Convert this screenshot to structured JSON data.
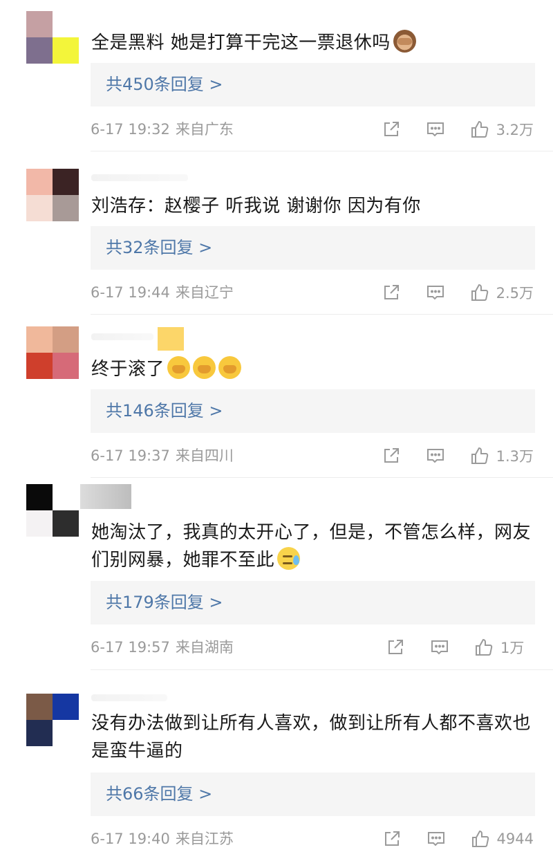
{
  "comments": [
    {
      "text": "全是黑料 她是打算干完这一票退休吗",
      "emojis": [
        "monkey"
      ],
      "reply_label": "共450条回复 >",
      "date": "6-17 19:32",
      "location": "来自广东",
      "likes": "3.2万",
      "avatar_colors": [
        "#c5a0a3",
        "#ffffff",
        "#7e6f8e",
        "#f3f53a"
      ]
    },
    {
      "text": "刘浩存：赵樱子 听我说 谢谢你 因为有你",
      "emojis": [],
      "reply_label": "共32条回复 >",
      "date": "6-17 19:44",
      "location": "来自辽宁",
      "likes": "2.5万",
      "avatar_colors": [
        "#f2b8a8",
        "#3b2324",
        "#f5ddd4",
        "#a89a97"
      ]
    },
    {
      "text": "终于滚了",
      "emojis": [
        "cry",
        "cry",
        "cry"
      ],
      "reply_label": "共146条回复 >",
      "date": "6-17 19:37",
      "location": "来自四川",
      "likes": "1.3万",
      "avatar_colors": [
        "#f0b89b",
        "#d39e84",
        "#cf3f2c",
        "#d66a78"
      ]
    },
    {
      "text": "她淘汰了，我真的太开心了，但是，不管怎么样，网友们别网暴，她罪不至此",
      "emojis": [
        "sweat"
      ],
      "reply_label": "共179条回复 >",
      "date": "6-17 19:57",
      "location": "来自湖南",
      "likes": "1万",
      "avatar_colors": [
        "#0a0a0a",
        "#ffffff",
        "#f4f2f3",
        "#2d2d2d"
      ]
    },
    {
      "text": "没有办法做到让所有人喜欢，做到让所有人都不喜欢也是蛮牛逼的",
      "emojis": [],
      "reply_label": "共66条回复 >",
      "date": "6-17 19:40",
      "location": "来自江苏",
      "likes": "4944",
      "avatar_colors": [
        "#7b5a47",
        "#1537a2",
        "#222d52",
        "#ffffff"
      ]
    }
  ],
  "icons": {
    "share": "share-icon",
    "comment": "comment-icon",
    "like": "thumbs-up-icon"
  },
  "colors": {
    "reply_link": "#4e77a8",
    "meta": "#9a9a9a",
    "reply_bg": "#f5f5f5"
  }
}
